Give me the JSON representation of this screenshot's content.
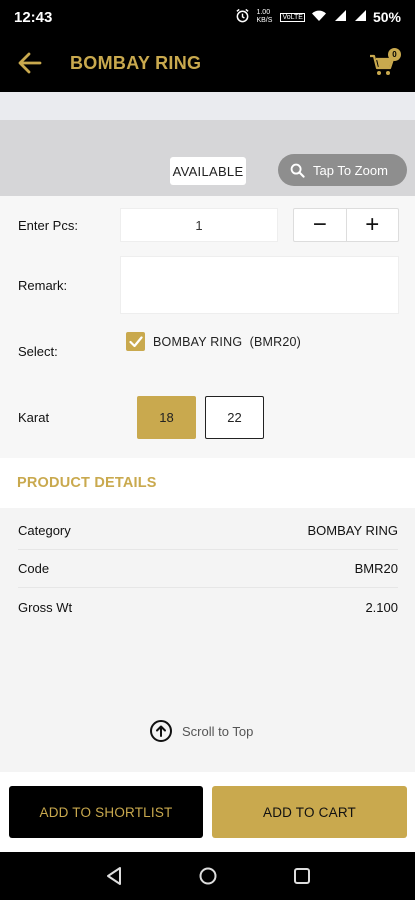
{
  "status_bar": {
    "time": "12:43",
    "network_speed": "1.00 KB/S",
    "volte": "VoLTE",
    "battery": "50%"
  },
  "app_bar": {
    "title": "BOMBAY RING",
    "cart_count": "0"
  },
  "image_area": {
    "availability": "AVAILABLE",
    "zoom_label": "Tap To Zoom"
  },
  "form": {
    "pcs_label": "Enter Pcs:",
    "pcs_value": "1",
    "minus": "−",
    "plus": "+",
    "remark_label": "Remark:",
    "remark_value": "",
    "select_label": "Select:",
    "select_option": "BOMBAY RING  (BMR20)",
    "select_checked": true,
    "karat_label": "Karat",
    "karat_options": [
      "18",
      "22"
    ],
    "karat_selected": "18"
  },
  "product_details": {
    "header": "PRODUCT DETAILS",
    "rows": [
      {
        "label": "Category",
        "value": "BOMBAY RING"
      },
      {
        "label": "Code",
        "value": "BMR20"
      },
      {
        "label": "Gross Wt",
        "value": "2.100"
      }
    ]
  },
  "scroll_to_top": "Scroll to Top",
  "actions": {
    "shortlist": "ADD TO SHORTLIST",
    "cart": "ADD TO CART"
  },
  "colors": {
    "accent_gold": "#c9a94e",
    "bar_black": "#000000"
  },
  "icons": [
    "back-arrow-icon",
    "cart-icon",
    "search-icon",
    "check-icon",
    "arrow-up-circle-icon",
    "nav-back-icon",
    "nav-home-icon",
    "nav-recents-icon"
  ]
}
